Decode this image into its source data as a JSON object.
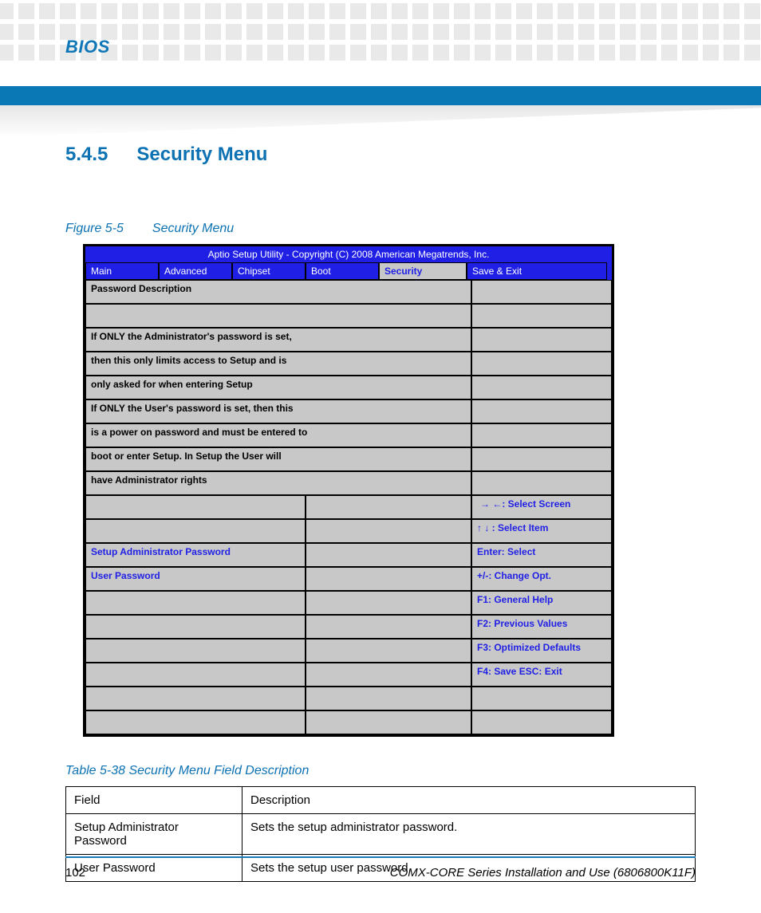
{
  "header": {
    "chapter": "BIOS"
  },
  "section": {
    "number": "5.4.5",
    "title": "Security Menu"
  },
  "figure": {
    "label": "Figure 5-5",
    "title": "Security Menu"
  },
  "bios": {
    "title": "Aptio Setup Utility - Copyright (C) 2008 American Megatrends, Inc.",
    "tabs": [
      "Main",
      "Advanced",
      "Chipset",
      "Boot",
      "Security",
      "Save & Exit"
    ],
    "active_tab": "Security",
    "left_column": [
      "Password Description",
      "",
      "If ONLY the Administrator's password is set,",
      "then this only limits access to Setup and is",
      "only asked for when entering Setup",
      "If ONLY the User's password is set, then this",
      "is a power on password and must be entered to",
      "boot or enter Setup. In Setup the User will",
      "have Administrator rights"
    ],
    "options": [
      "Setup Administrator Password",
      "User Password"
    ],
    "help": [
      "→ ←: Select Screen",
      "↑ ↓ : Select Item",
      "Enter: Select",
      "+/-: Change Opt.",
      "F1: General Help",
      "F2: Previous Values",
      "F3: Optimized Defaults",
      "F4: Save   ESC: Exit"
    ]
  },
  "table": {
    "caption": "Table 5-38 Security Menu Field Description",
    "headers": {
      "field": "Field",
      "desc": "Description"
    },
    "rows": [
      {
        "field": "Setup Administrator Password",
        "desc": "Sets the setup administrator password."
      },
      {
        "field": "User Password",
        "desc": "Sets the setup user password."
      }
    ]
  },
  "footer": {
    "page": "102",
    "doc": "COMX-CORE Series Installation and Use (6806800K11F)"
  }
}
